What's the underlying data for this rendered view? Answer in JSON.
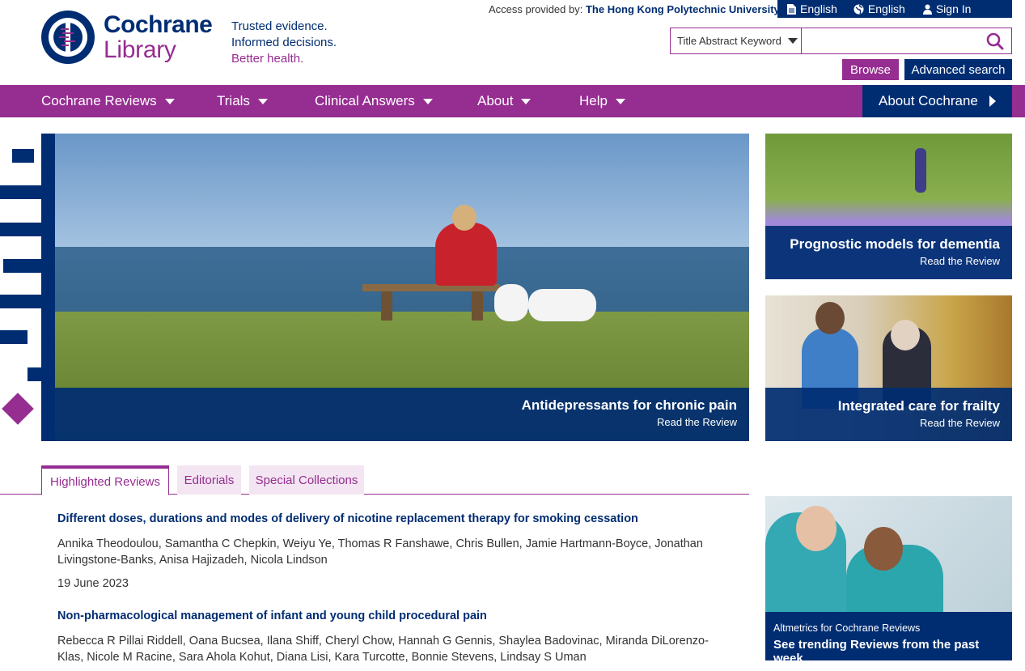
{
  "header": {
    "access_label": "Access provided by:",
    "access_org": "The Hong Kong Polytechnic University",
    "util": [
      {
        "icon": "document-icon",
        "label": "English"
      },
      {
        "icon": "globe-icon",
        "label": "English"
      },
      {
        "icon": "user-icon",
        "label": "Sign In"
      }
    ],
    "brand_line1": "Cochrane",
    "brand_line2": "Library",
    "tagline": [
      "Trusted evidence.",
      "Informed decisions.",
      "Better health."
    ]
  },
  "search": {
    "scope": "Title Abstract Keyword",
    "value": "",
    "browse_label": "Browse",
    "advanced_label": "Advanced search"
  },
  "nav": {
    "items": [
      "Cochrane Reviews",
      "Trials",
      "Clinical Answers",
      "About",
      "Help"
    ],
    "about_cochrane": "About Cochrane"
  },
  "hero": {
    "title": "Antidepressants for chronic pain",
    "subtitle": "Read the Review"
  },
  "tiles": [
    {
      "title": "Prognostic models for dementia",
      "subtitle": "Read the Review"
    },
    {
      "title": "Integrated care for frailty",
      "subtitle": "Read the Review"
    }
  ],
  "tabs": [
    "Highlighted Reviews",
    "Editorials",
    "Special Collections"
  ],
  "reviews": [
    {
      "title": "Different doses, durations and modes of delivery of nicotine replacement therapy for smoking cessation",
      "authors": "Annika Theodoulou, Samantha C Chepkin, Weiyu Ye, Thomas R Fanshawe, Chris Bullen, Jamie Hartmann-Boyce, Jonathan Livingstone-Banks, Anisa Hajizadeh, Nicola Lindson",
      "date": "19 June 2023"
    },
    {
      "title": "Non-pharmacological management of infant and young child procedural pain",
      "authors": "Rebecca R Pillai Riddell, Oana Bucsea, Ilana Shiff, Cheryl Chow, Hannah G Gennis, Shaylea Badovinac, Miranda DiLorenzo-Klas, Nicole M Racine, Sara Ahola Kohut, Diana Lisi, Kara Turcotte, Bonnie Stevens, Lindsay S Uman",
      "date": ""
    }
  ],
  "altmetrics": {
    "small": "Altmetrics for Cochrane Reviews",
    "big": "See trending Reviews from the past week"
  },
  "colors": {
    "navy": "#002d72",
    "purple": "#962d91"
  }
}
